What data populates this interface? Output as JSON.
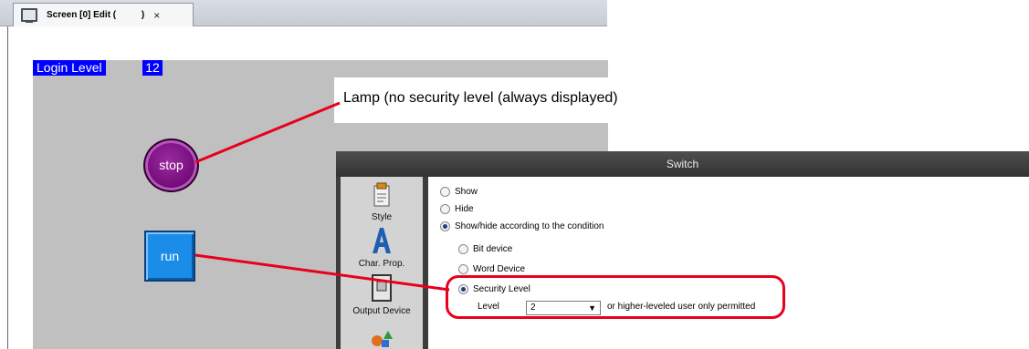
{
  "editor": {
    "tab_title": "Screen [0] Edit (          )",
    "tab_close": "×",
    "login_level_label": "Login Level",
    "login_level_value": "12",
    "lamp_label": "stop",
    "switch_label": "run",
    "callout_text": "Lamp (no security level (always displayed)"
  },
  "dialog": {
    "title": "Switch",
    "sidebar": [
      {
        "label": "Style",
        "icon": "style-icon"
      },
      {
        "label": "Char. Prop.",
        "icon": "char-prop-icon"
      },
      {
        "label": "Output Device",
        "icon": "output-device-icon"
      },
      {
        "label": "",
        "icon": "shapes-icon"
      }
    ],
    "options": {
      "show": "Show",
      "hide": "Hide",
      "conditional": "Show/hide according to the condition",
      "bit_device": "Bit device",
      "word_device": "Word Device",
      "security_level": "Security Level"
    },
    "selected_option": "conditional",
    "selected_condition": "security_level",
    "level_label": "Level",
    "level_value": "2",
    "level_suffix": "or higher-leveled user only permitted"
  },
  "colors": {
    "highlight": "#e8001c",
    "login_bg": "#0000ff",
    "run_button": "#1b8de8",
    "lamp": "#7a107f"
  }
}
